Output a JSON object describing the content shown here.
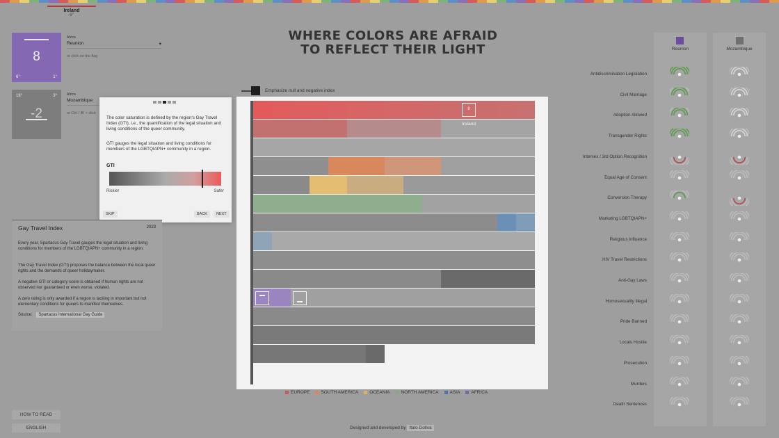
{
  "top_marker": {
    "name": "Ireland",
    "value": "6°"
  },
  "card_primary": {
    "score": "8",
    "bottom_left": "6°",
    "bottom_right": "1°"
  },
  "card_secondary": {
    "score": "-2",
    "top_left": "16°",
    "top_right": "3°"
  },
  "selector_primary": {
    "continent": "Africa",
    "region": "Reunion",
    "hint": "or click on the flag"
  },
  "selector_secondary": {
    "continent": "Africa",
    "region": "Mozambique",
    "hint": "or Ctrl / ⌘ + click"
  },
  "title": {
    "line1": "WHERE COLORS ARE AFRAID",
    "line2": "TO REFLECT THEIR LIGHT"
  },
  "emphasize_toggle": "Emphasize null and negative index",
  "tooltip": {
    "p1": "The color saturation is defined by the region's Gay Travel Index (GTI), i.e., the quantification of the legal situation and living conditions of the queer community.",
    "p2": "GTI gauges the legal situation and living conditions for members of the LGBTQIAPN+ community in a region.",
    "gti_label": "GTI",
    "riskier": "Riskier",
    "safer": "Safer",
    "skip": "SKIP",
    "back": "BACK",
    "next": "NEXT"
  },
  "gti_panel": {
    "title": "Gay Travel Index",
    "year": "2023",
    "p1": "Every year, Spartacus Gay Travel gauges the legal situation and living conditions for members of the LGBTQIAPN+ community in a region.",
    "p2": "The Gay Travel Index (GTI) proposes the balance between the local queer rights and the demands of queer holidaymaker.",
    "p3": "A negative GTI or category score is obtained if human rights are not observed nor guaranteed or even worse, violated.",
    "p4": "A zero rating is only awarded if a region is lacking in important but not elementary conditions for queers to manifest themselves.",
    "source_label": "Source:",
    "source_name": "Spartacus International Gay Guide"
  },
  "chart_marker": {
    "label": "Ireland",
    "value": "8"
  },
  "legend": [
    {
      "label": "EUROPE",
      "color": "#c65a58"
    },
    {
      "label": "SOUTH AMERICA",
      "color": "#d8865a"
    },
    {
      "label": "OCEANIA",
      "color": "#d7b36a"
    },
    {
      "label": "NORTH AMERICA",
      "color": "#84a983"
    },
    {
      "label": "ASIA",
      "color": "#4d74a6"
    },
    {
      "label": "AFRICA",
      "color": "#7b62ab"
    }
  ],
  "criteria": [
    "Antidiscrimination Legislation",
    "Civil Marriage",
    "Adoption Allowed",
    "Transgender Rights",
    "Intersex / 3rd Option Recognition",
    "Equal Age of Consent",
    "Conversion Therapy",
    "Marketing LGBTQIAPN+",
    "Religious Influence",
    "HIV Travel Restrictions",
    "Anti-Gay Laws",
    "Homosexuality Illegal",
    "Pride Banned",
    "Locals Hostile",
    "Prosecution",
    "Murders",
    "Death Sentences"
  ],
  "columns": [
    {
      "name": "Reunion"
    },
    {
      "name": "Mozambique"
    }
  ],
  "buttons": {
    "how_to_read": "HOW TO READ",
    "language": "ENGLISH"
  },
  "credit": {
    "text": "Designed and developed by",
    "author": "Italo Doliva"
  }
}
